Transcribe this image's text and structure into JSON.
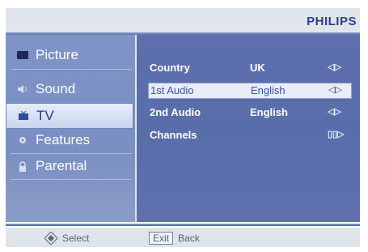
{
  "brand": "PHILIPS",
  "sidebar": {
    "items": [
      {
        "label": "Picture",
        "icon": "picture-icon"
      },
      {
        "label": "Sound",
        "icon": "speaker-icon"
      },
      {
        "label": "TV",
        "icon": "tv-icon"
      },
      {
        "label": "Features",
        "icon": "gear-icon"
      },
      {
        "label": "Parental",
        "icon": "lock-icon"
      }
    ],
    "selected": "TV"
  },
  "panel": {
    "rows": [
      {
        "label": "Country",
        "value": "UK",
        "arrows": "◁▷"
      },
      {
        "label": "1st Audio",
        "value": "English",
        "arrows": "◁▷"
      },
      {
        "label": "2nd Audio",
        "value": "English",
        "arrows": "◁▷"
      },
      {
        "label": "Channels",
        "value": "",
        "arrows": "▯▯▷"
      }
    ],
    "selected_row": "1st Audio"
  },
  "footer": {
    "select_label": "Select",
    "exit_key": "Exit",
    "back_label": "Back"
  },
  "colors": {
    "brand": "#2a3f8f",
    "sidebar": "#7e94c6",
    "panel": "#5d6fae",
    "selection": "#e8edf7"
  }
}
